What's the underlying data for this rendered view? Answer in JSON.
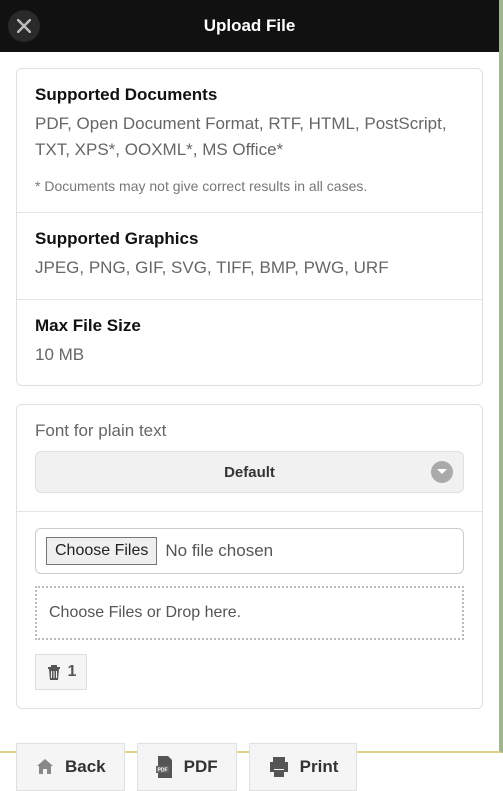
{
  "header": {
    "title": "Upload File"
  },
  "supported_docs": {
    "title": "Supported Documents",
    "body": "PDF, Open Document Format, RTF, HTML, PostScript, TXT, XPS*, OOXML*, MS Office*",
    "note": "* Documents may not give correct results in all cases."
  },
  "supported_graphics": {
    "title": "Supported Graphics",
    "body": "JPEG, PNG, GIF, SVG, TIFF, BMP, PWG, URF"
  },
  "max_file_size": {
    "title": "Max File Size",
    "value": "10 MB"
  },
  "font_select": {
    "label": "Font for plain text",
    "selected": "Default"
  },
  "uploader": {
    "choose_button": "Choose Files",
    "no_file_text": "No file chosen",
    "dropzone_text": "Choose Files or Drop here.",
    "trash_count": "1"
  },
  "footer": {
    "back": "Back",
    "pdf": "PDF",
    "print": "Print"
  }
}
